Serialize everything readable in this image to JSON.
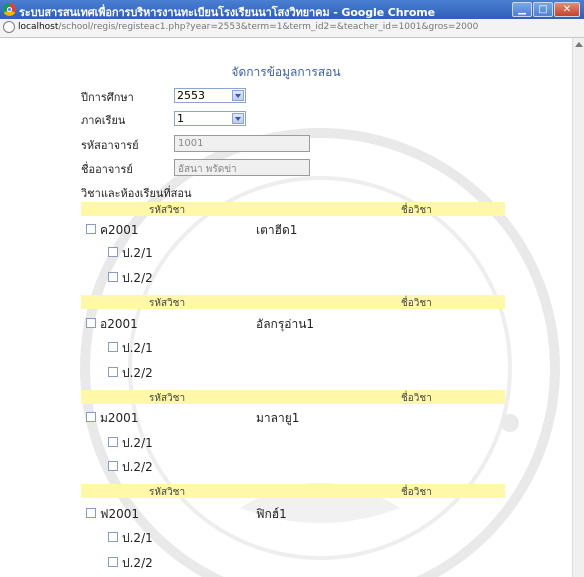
{
  "window": {
    "title": "ระบบสารสนเทศเพื่อการบริหารงานทะเบียนโรงเรียนนาโสงวิทยาคม - Google Chrome",
    "url_host": "localhost",
    "url_path": "/school/regis/registeac1.php?year=2553&term=1&term_id2=&teacher_id=1001&gros=2000"
  },
  "page": {
    "title": "จัดการข้อมูลการสอน",
    "year_label": "ปีการศึกษา",
    "year_value": "2553",
    "term_label": "ภาคเรียน",
    "term_value": "1",
    "teacher_id_label": "รหัสอาจารย์",
    "teacher_id_value": "1001",
    "teacher_name_label": "ชื่ออาจารย์",
    "teacher_name_value": "อัสนา พรัดข่า",
    "section_label": "วิชาและห้องเรียนที่สอน"
  },
  "subjects": [
    {
      "header_code": "รหัสวิชา",
      "header_name": "ชื่อวิชา",
      "code": "ค2001",
      "name": "เตาฮีด1",
      "rooms": [
        "ป.2/1",
        "ป.2/2"
      ]
    },
    {
      "header_code": "รหัสวิชา",
      "header_name": "ชื่อวิชา",
      "code": "อ2001",
      "name": "อัลกรุอ่าน1",
      "rooms": [
        "ป.2/1",
        "ป.2/2"
      ]
    },
    {
      "header_code": "รหัสวิชา",
      "header_name": "ชื่อวิชา",
      "code": "ม2001",
      "name": "มาลายู1",
      "rooms": [
        "ป.2/1",
        "ป.2/2"
      ]
    },
    {
      "header_code": "รหัสวิชา",
      "header_name": "ชื่อวิชา",
      "code": "ฟ2001",
      "name": "ฟิกฮ์1",
      "rooms": [
        "ป.2/1",
        "ป.2/2"
      ]
    }
  ],
  "icons": {
    "browser": "chrome-logo-icon",
    "minimize": "minimize-icon",
    "maximize": "maximize-icon",
    "close": "close-icon",
    "page": "page-info-icon",
    "dropdown": "chevron-down-icon"
  },
  "colors": {
    "titlebar": "#2f5fb8",
    "page_title": "#3a5ea8",
    "subject_header_bg": "#fef8a8"
  }
}
